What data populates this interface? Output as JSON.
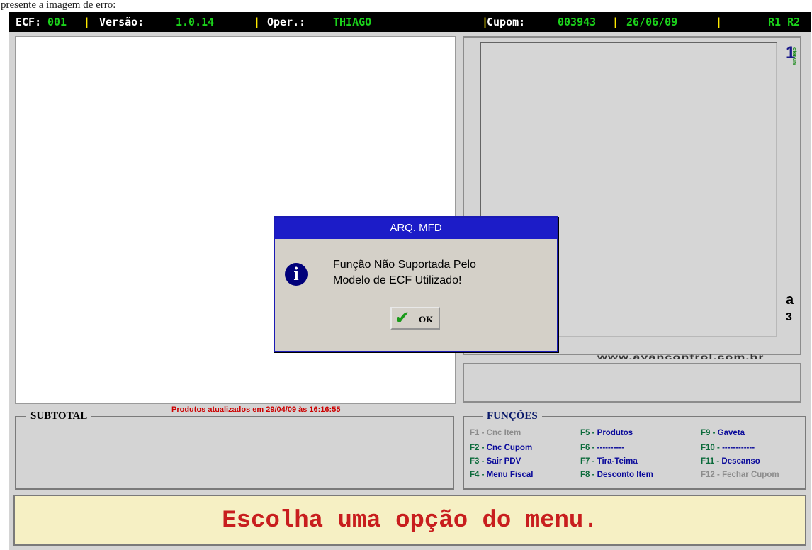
{
  "caption": "presente a imagem de erro:",
  "status_bar": {
    "ecf_label": "ECF:",
    "ecf_value": "001",
    "version_label": "Versão:",
    "version_value": "1.0.14",
    "operator_label": "Oper.:",
    "operator_value": "THIAGO",
    "coupon_label": "Cupom:",
    "coupon_value": "003943",
    "date": "26/06/09",
    "flags": "R1 R2",
    "separator": "|"
  },
  "logo": {
    "glyph_top": "1",
    "vertical_text": "ofenum",
    "glyph_mid": "a",
    "glyph_num": "3",
    "website": "www.avancontrol.com.br"
  },
  "notice": "Produtos atualizados em 29/04/09 às 16:16:55",
  "subtotal": {
    "legend": "SUBTOTAL"
  },
  "functions": {
    "legend": "FUNÇÕES",
    "keys": [
      {
        "key": "F1",
        "label": "Cnc Item"
      },
      {
        "key": "F2",
        "label": "Cnc Cupom"
      },
      {
        "key": "F3",
        "label": "Sair PDV"
      },
      {
        "key": "F4",
        "label": "Menu Fiscal"
      },
      {
        "key": "F5",
        "label": "Produtos"
      },
      {
        "key": "F6",
        "label": "----------"
      },
      {
        "key": "F7",
        "label": "Tira-Teima"
      },
      {
        "key": "F8",
        "label": "Desconto Item"
      },
      {
        "key": "F9",
        "label": " Gaveta"
      },
      {
        "key": "F10",
        "label": "------------"
      },
      {
        "key": "F11",
        "label": "Descanso"
      },
      {
        "key": "F12",
        "label": "Fechar Cupom"
      }
    ],
    "dash": " - "
  },
  "message": "Escolha uma opção do menu.",
  "dialog": {
    "title": "ARQ. MFD",
    "line1": "Função Não Suportada Pelo",
    "line2": "Modelo de ECF Utilizado!",
    "icon": "info-icon",
    "ok_label": "OK"
  },
  "colors": {
    "status_value": "#1bd21b",
    "status_separator": "#ffea00",
    "dialog_title_bg": "#1c1cc8",
    "message_text": "#c81e1e",
    "message_bg": "#f6f0c4"
  }
}
